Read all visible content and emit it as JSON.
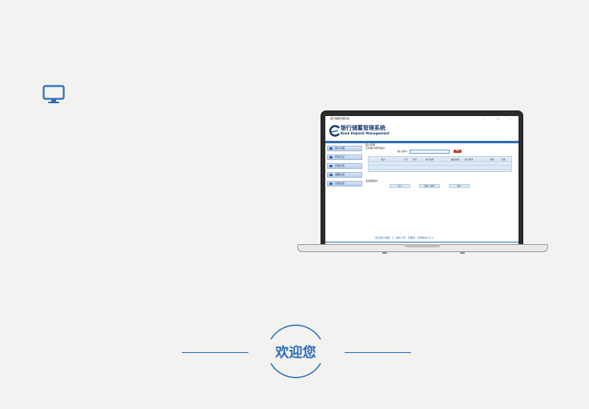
{
  "app": {
    "window_title": "银行储蓄管理系统",
    "name_cn": "银行储蓄管理系统",
    "name_en": "Bank Deposit Management",
    "win_controls": "— □ ×"
  },
  "sidebar": {
    "items": [
      {
        "label": "客户管理"
      },
      {
        "label": "存款汇总"
      },
      {
        "label": "查询记录"
      },
      {
        "label": "储蓄设置"
      },
      {
        "label": "系统设置"
      }
    ]
  },
  "main": {
    "section_title": "客户管理",
    "subtitle": "已存客户账号信息:",
    "input_label": "输入账户:",
    "query_button": "查询",
    "columns": [
      "账户",
      "户主",
      "存款",
      "开户日期",
      "最近日期",
      "客户经理",
      "余额",
      "状态"
    ],
    "ops_label": "请选择操作:",
    "buttons": [
      "存户",
      "取款、删除",
      "销户"
    ],
    "footer": "当日账户总数：0，操作人员：管理员，系统版本 V1.0"
  },
  "welcome": {
    "text": "欢迎您"
  },
  "colors": {
    "accent": "#2d6db5",
    "header_text": "#1a3a6e",
    "background": "#f2f2f0"
  },
  "icons": {
    "top_left": "monitor-icon",
    "app_logo": "bank-logo-icon"
  }
}
